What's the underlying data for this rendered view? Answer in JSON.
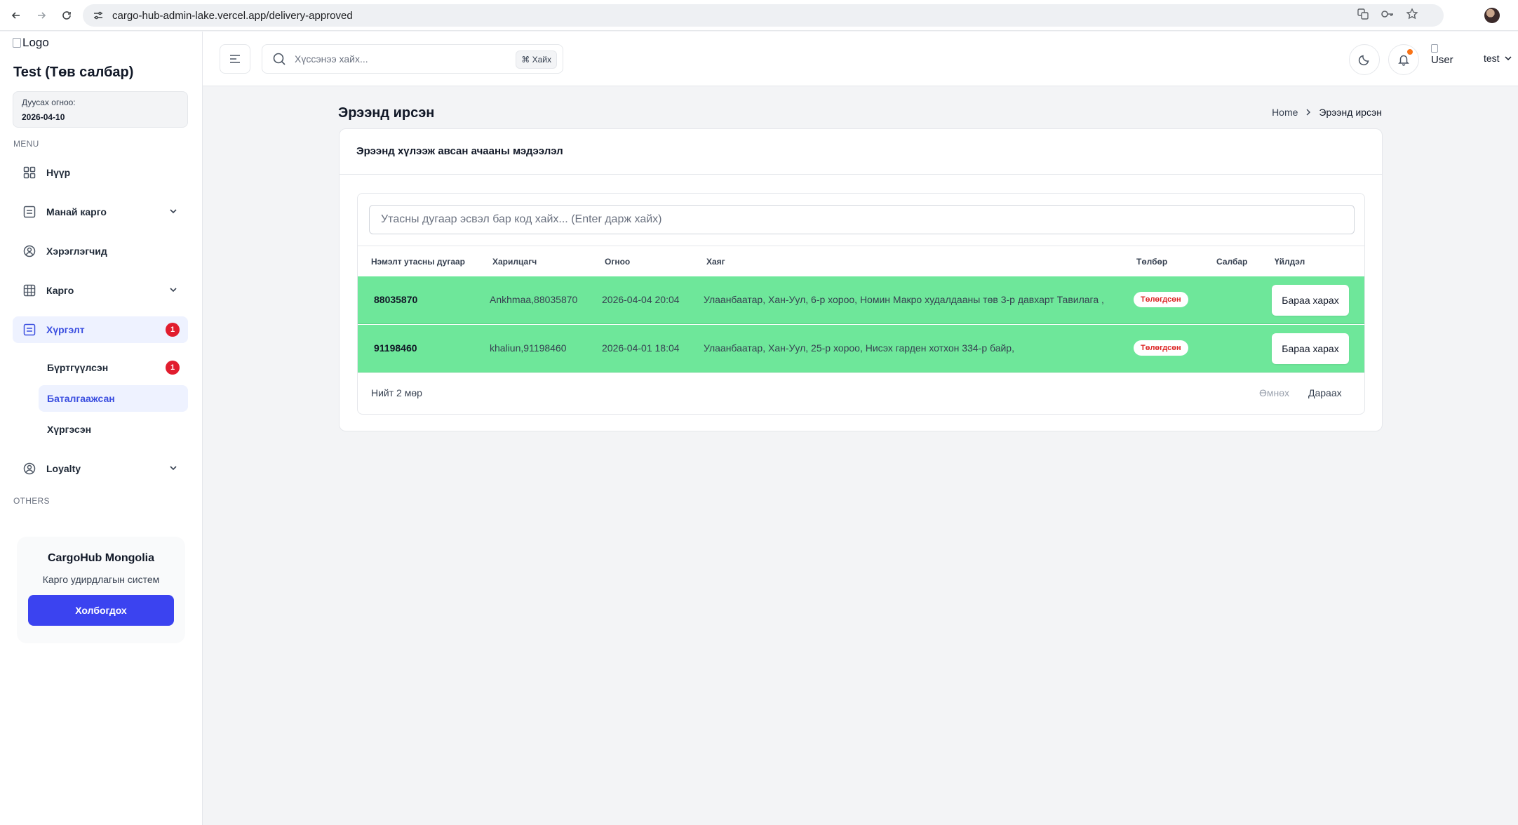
{
  "browser": {
    "url": "cargo-hub-admin-lake.vercel.app/delivery-approved"
  },
  "sidebar": {
    "logo_alt": "Logo",
    "branch_title": "Test (Төв салбар)",
    "expiry_label": "Дуусах огноо:",
    "expiry_date": "2026-04-10",
    "menu_section": "MENU",
    "others_section": "OTHERS",
    "items": [
      {
        "label": "Нүүр",
        "icon": "grid-icon"
      },
      {
        "label": "Манай карго",
        "icon": "list-icon",
        "expandable": true
      },
      {
        "label": "Хэрэглэгчид",
        "icon": "user-circle-icon"
      },
      {
        "label": "Карго",
        "icon": "table-icon",
        "expandable": true
      },
      {
        "label": "Хүргэлт",
        "icon": "list-icon",
        "badge": "1",
        "active": true
      },
      {
        "label": "Loyalty",
        "icon": "user-circle-icon",
        "expandable": true
      }
    ],
    "sub_items": [
      {
        "label": "Бүртгүүлсэн",
        "badge": "1"
      },
      {
        "label": "Баталгаажсан",
        "active": true
      },
      {
        "label": "Хүргэсэн"
      }
    ],
    "promo": {
      "title": "CargoHub Mongolia",
      "subtitle": "Карго удирдлагын систем",
      "button": "Холбогдох"
    }
  },
  "header": {
    "search_placeholder": "Хүссэнээ хайх...",
    "search_shortcut": "⌘ Хайх",
    "user_alt": "User",
    "user_name": "test"
  },
  "page": {
    "title": "Эрээнд ирсэн",
    "breadcrumb": [
      "Home",
      "Эрээнд ирсэн"
    ]
  },
  "card": {
    "title": "Эрээнд хүлээж авсан ачааны мэдээлэл",
    "search_placeholder": "Утасны дугаар эсвэл бар код хайх... (Enter дарж хайх)",
    "columns": [
      "Нэмэлт утасны дугаар",
      "Харилцагч",
      "Огноо",
      "Хаяг",
      "Төлбөр",
      "Салбар",
      "Үйлдэл"
    ],
    "rows": [
      {
        "phone": "88035870",
        "customer": "Ankhmaa,88035870",
        "date": "2026-04-04 20:04",
        "address": "Улаанбаатар, Хан-Уул, 6-р хороо, Номин Макро худалдааны төв 3-р давхарт Тавилага ,",
        "payment": "Төлөгдсөн",
        "branch": "",
        "action": "Бараа харах"
      },
      {
        "phone": "91198460",
        "customer": "khaliun,91198460",
        "date": "2026-04-01 18:04",
        "address": "Улаанбаатар, Хан-Уул, 25-р хороо, Нисэх гарден хотхон 334-р байр,",
        "payment": "Төлөгдсөн",
        "branch": "",
        "action": "Бараа харах"
      }
    ],
    "total": "Нийт 2 мөр",
    "prev": "Өмнөх",
    "next": "Дараах"
  },
  "colors": {
    "accent": "#3b43f0",
    "row_highlight": "#6ee79a",
    "badge_red": "#e11d2e",
    "notification_dot": "#f97316"
  }
}
